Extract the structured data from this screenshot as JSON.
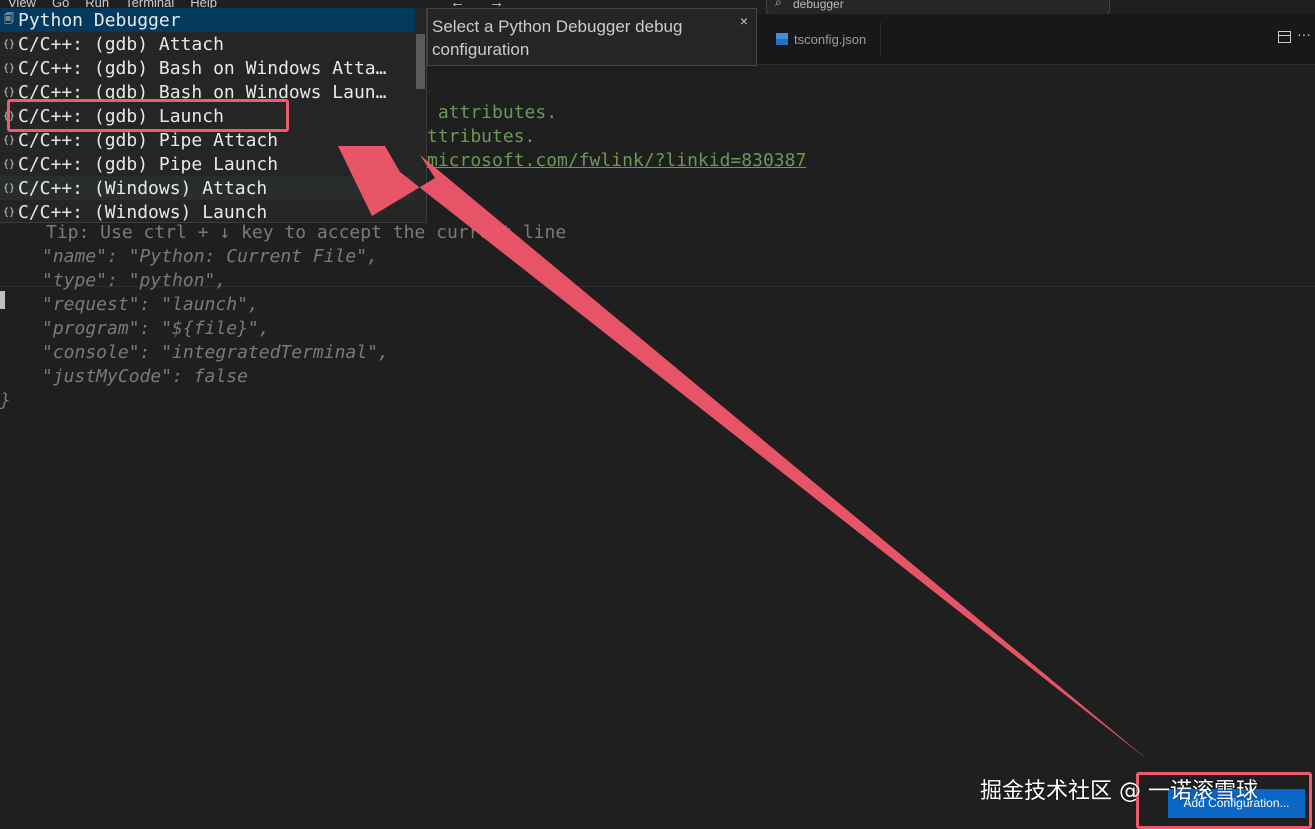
{
  "menu": [
    "View",
    "Go",
    "Run",
    "Terminal",
    "Help"
  ],
  "nav_arrows": "← →",
  "command_center": {
    "value": "debugger"
  },
  "tabs": [
    {
      "label": "tsconfig.json"
    }
  ],
  "tab_actions": {
    "more": "···"
  },
  "quick_pick": {
    "items": [
      {
        "label": "Python Debugger",
        "icon": "python-icon",
        "state": "active"
      },
      {
        "label": "C/C++: (gdb) Attach",
        "icon": "braces-icon"
      },
      {
        "label": "C/C++: (gdb) Bash on Windows Atta…",
        "icon": "braces-icon"
      },
      {
        "label": "C/C++: (gdb) Bash on Windows Laun…",
        "icon": "braces-icon"
      },
      {
        "label": "C/C++: (gdb) Launch",
        "icon": "braces-icon",
        "highlighted": true
      },
      {
        "label": "C/C++: (gdb) Pipe Attach",
        "icon": "braces-icon"
      },
      {
        "label": "C/C++: (gdb) Pipe Launch",
        "icon": "braces-icon"
      },
      {
        "label": "C/C++: (Windows) Attach",
        "icon": "braces-icon",
        "state": "hover"
      },
      {
        "label": "C/C++: (Windows) Launch",
        "icon": "braces-icon"
      }
    ],
    "bracket_glyph": "{}"
  },
  "tooltip": {
    "text": "Select a Python Debugger debug configuration",
    "close": "×"
  },
  "editor": {
    "comment_lines": [
      " attributes.",
      "ttributes.",
      "microsoft.com/fwlink/?linkid=830387"
    ],
    "tip": "Tip: Use ctrl + ↓ key to accept the current line",
    "ghost_lines": [
      "\"name\": \"Python: Current File\",",
      "\"type\": \"python\",",
      "\"request\": \"launch\",",
      "\"program\": \"${file}\",",
      "\"console\": \"integratedTerminal\",",
      "\"justMyCode\": false"
    ],
    "closing_brace": "}"
  },
  "add_configuration": "Add Configuration...",
  "watermark": "掘金技术社区 @ 一诺滚雪球",
  "colors": {
    "annotation": "#ef5a6f",
    "accent": "#0a67c6",
    "selection": "#04395e"
  }
}
